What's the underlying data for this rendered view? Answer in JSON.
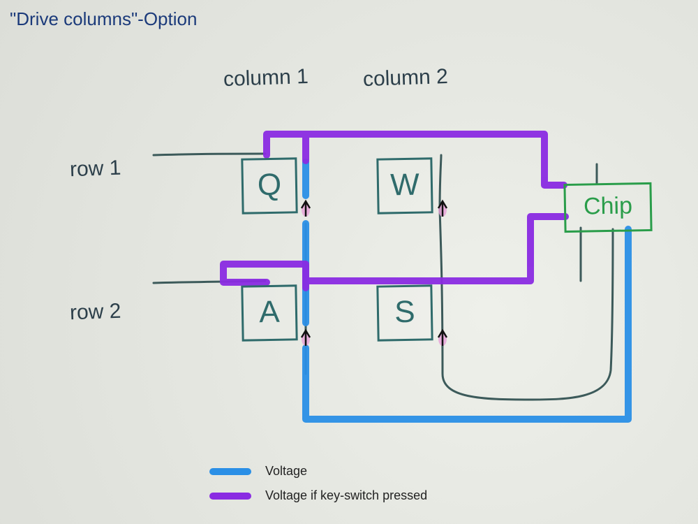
{
  "title": "\"Drive columns\"-Option",
  "columns": [
    "column 1",
    "column 2"
  ],
  "rows": [
    "row 1",
    "row 2"
  ],
  "keys": {
    "r1c1": "Q",
    "r1c2": "W",
    "r2c1": "A",
    "r2c2": "S"
  },
  "chip": "Chip",
  "legend": {
    "voltage": "Voltage",
    "voltage_pressed": "Voltage if key-switch pressed"
  },
  "colors": {
    "voltage": "#2a8fe6",
    "voltage_pressed": "#8a2be2",
    "wire": "#3c5a5a",
    "key_border": "#2f6b6b",
    "chip_border": "#2a9d4a",
    "title": "#1b3a7a"
  },
  "diagram": {
    "type": "keyboard-scan-matrix",
    "drive": "columns",
    "sense": "rows",
    "switch_grid": [
      [
        "Q",
        "W"
      ],
      [
        "A",
        "S"
      ]
    ],
    "diodes_from": "column_wire",
    "diodes_to": "row_wire"
  }
}
